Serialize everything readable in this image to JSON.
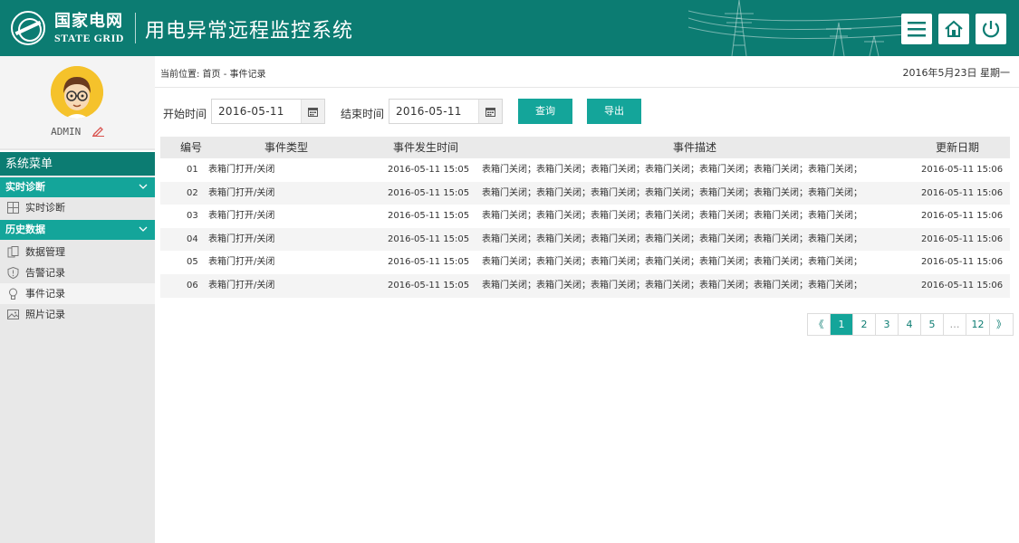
{
  "header": {
    "logo_cn": "国家电网",
    "logo_en": "STATE GRID",
    "title": "用电异常远程监控系统",
    "buttons": [
      "menu-icon",
      "home-icon",
      "power-icon"
    ]
  },
  "user": {
    "name": "ADMIN"
  },
  "sidebar": {
    "title": "系统菜单",
    "groups": [
      {
        "label": "实时诊断",
        "items": [
          {
            "label": "实时诊断",
            "icon": "grid-icon"
          }
        ]
      },
      {
        "label": "历史数据",
        "items": [
          {
            "label": "数据管理",
            "icon": "database-icon"
          },
          {
            "label": "告警记录",
            "icon": "shield-icon"
          },
          {
            "label": "事件记录",
            "icon": "bulb-icon"
          },
          {
            "label": "照片记录",
            "icon": "photo-icon"
          }
        ]
      }
    ]
  },
  "breadcrumb": "当前位置: 首页 - 事件记录",
  "date": "2016年5月23日 星期一",
  "filters": {
    "start_label": "开始时间",
    "start_value": "2016-05-11",
    "end_label": "结束时间",
    "end_value": "2016-05-11",
    "query_btn": "查询",
    "export_btn": "导出"
  },
  "table": {
    "headers": [
      "编号",
      "事件类型",
      "事件发生时间",
      "事件描述",
      "更新日期"
    ],
    "rows": [
      [
        "01",
        "表箱门打开/关闭",
        "2016-05-11 15:05",
        "表箱门关闭；表箱门关闭；表箱门关闭；表箱门关闭；表箱门关闭；表箱门关闭；表箱门关闭；",
        "2016-05-11 15:06"
      ],
      [
        "02",
        "表箱门打开/关闭",
        "2016-05-11 15:05",
        "表箱门关闭；表箱门关闭；表箱门关闭；表箱门关闭；表箱门关闭；表箱门关闭；表箱门关闭；",
        "2016-05-11 15:06"
      ],
      [
        "03",
        "表箱门打开/关闭",
        "2016-05-11 15:05",
        "表箱门关闭；表箱门关闭；表箱门关闭；表箱门关闭；表箱门关闭；表箱门关闭；表箱门关闭；",
        "2016-05-11 15:06"
      ],
      [
        "04",
        "表箱门打开/关闭",
        "2016-05-11 15:05",
        "表箱门关闭；表箱门关闭；表箱门关闭；表箱门关闭；表箱门关闭；表箱门关闭；表箱门关闭；",
        "2016-05-11 15:06"
      ],
      [
        "05",
        "表箱门打开/关闭",
        "2016-05-11 15:05",
        "表箱门关闭；表箱门关闭；表箱门关闭；表箱门关闭；表箱门关闭；表箱门关闭；表箱门关闭；",
        "2016-05-11 15:06"
      ],
      [
        "06",
        "表箱门打开/关闭",
        "2016-05-11 15:05",
        "表箱门关闭；表箱门关闭；表箱门关闭；表箱门关闭；表箱门关闭；表箱门关闭；表箱门关闭；",
        "2016-05-11 15:06"
      ]
    ]
  },
  "pagination": {
    "prev": "《",
    "pages": [
      "1",
      "2",
      "3",
      "4",
      "5",
      "…",
      "12"
    ],
    "current": "1",
    "next": "》"
  },
  "colors": {
    "primary": "#0c7c72",
    "accent": "#14a59a"
  }
}
